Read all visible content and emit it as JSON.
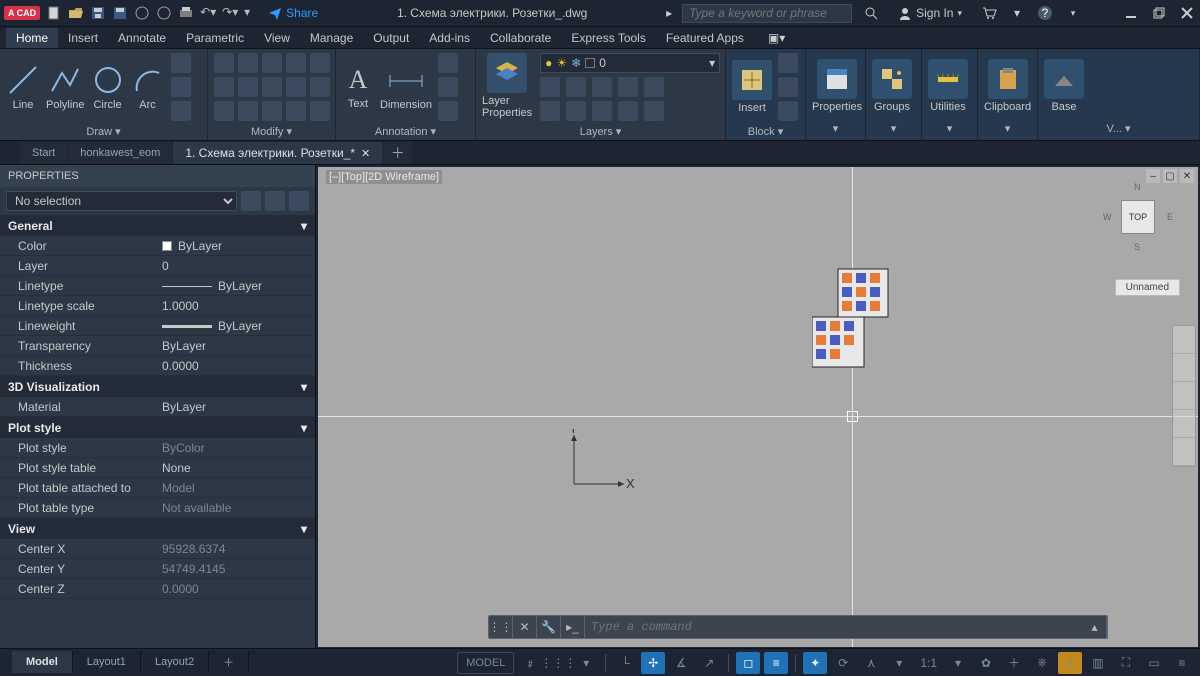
{
  "app": {
    "badge": "A CAD",
    "docname": "1. Схема электрики. Розетки_.dwg",
    "search_placeholder": "Type a keyword or phrase",
    "signin": "Sign In",
    "share": "Share"
  },
  "menu": {
    "items": [
      "Home",
      "Insert",
      "Annotate",
      "Parametric",
      "View",
      "Manage",
      "Output",
      "Add-ins",
      "Collaborate",
      "Express Tools",
      "Featured Apps"
    ],
    "active": 0
  },
  "ribbon": {
    "draw": {
      "title": "Draw ▾",
      "line": "Line",
      "polyline": "Polyline",
      "circle": "Circle",
      "arc": "Arc"
    },
    "modify": {
      "title": "Modify ▾"
    },
    "annotation": {
      "title": "Annotation ▾",
      "text": "Text",
      "dimension": "Dimension"
    },
    "layers": {
      "title": "Layers ▾",
      "layerprops": "Layer\nProperties",
      "current": "0"
    },
    "block": {
      "title": "Block ▾",
      "insert": "Insert"
    },
    "properties": {
      "title": "▾",
      "label": "Properties"
    },
    "groups": {
      "title": "▾",
      "label": "Groups"
    },
    "utilities": {
      "title": "▾",
      "label": "Utilities"
    },
    "clipboard": {
      "title": "▾",
      "label": "Clipboard"
    },
    "view": {
      "title": "V... ▾",
      "label": "Base"
    }
  },
  "filetabs": [
    {
      "label": "Start",
      "active": false
    },
    {
      "label": "honkawest_eom",
      "active": false
    },
    {
      "label": "1. Схема электрики. Розетки_*",
      "active": true
    }
  ],
  "properties": {
    "panel_title": "PROPERTIES",
    "selection": "No selection",
    "groups": [
      {
        "name": "General",
        "rows": [
          {
            "k": "Color",
            "v": "ByLayer",
            "swatch": true
          },
          {
            "k": "Layer",
            "v": "0"
          },
          {
            "k": "Linetype",
            "v": "ByLayer",
            "line": true
          },
          {
            "k": "Linetype scale",
            "v": "1.0000"
          },
          {
            "k": "Lineweight",
            "v": "ByLayer",
            "line": "thick"
          },
          {
            "k": "Transparency",
            "v": "ByLayer"
          },
          {
            "k": "Thickness",
            "v": "0.0000"
          }
        ]
      },
      {
        "name": "3D Visualization",
        "rows": [
          {
            "k": "Material",
            "v": "ByLayer"
          }
        ]
      },
      {
        "name": "Plot style",
        "rows": [
          {
            "k": "Plot style",
            "v": "ByColor",
            "ro": true
          },
          {
            "k": "Plot style table",
            "v": "None"
          },
          {
            "k": "Plot table attached to",
            "v": "Model",
            "ro": true
          },
          {
            "k": "Plot table type",
            "v": "Not available",
            "ro": true
          }
        ]
      },
      {
        "name": "View",
        "rows": [
          {
            "k": "Center X",
            "v": "95928.6374",
            "ro": true
          },
          {
            "k": "Center Y",
            "v": "54749.4145",
            "ro": true
          },
          {
            "k": "Center Z",
            "v": "0.0000",
            "ro": true
          }
        ]
      }
    ]
  },
  "drawing": {
    "label": "[–][Top][2D Wireframe]",
    "viewcube": "TOP",
    "viewcube_label": "Unnamed",
    "ucs_x": "X",
    "ucs_y": "Y"
  },
  "cmdline": {
    "placeholder": "Type a command"
  },
  "layouttabs": [
    {
      "label": "Model",
      "active": true
    },
    {
      "label": "Layout1",
      "active": false
    },
    {
      "label": "Layout2",
      "active": false
    }
  ],
  "statusbar": {
    "model": "MODEL",
    "scale": "1:1"
  }
}
